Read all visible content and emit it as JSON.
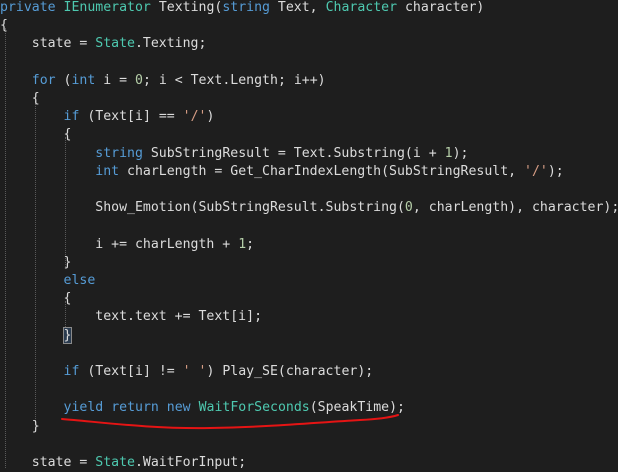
{
  "colors": {
    "background": "#1e1e1e",
    "plain": "#dcdcdc",
    "keyword": "#569cd6",
    "type": "#4ec9b0",
    "string": "#d69d85",
    "number": "#b5cea8",
    "squiggle": "#e51414",
    "indent_guide": "#5a5a5a"
  },
  "code_lines": [
    {
      "tokens": [
        {
          "t": "private",
          "c": "keyword"
        },
        {
          "t": " "
        },
        {
          "t": "IEnumerator",
          "c": "type"
        },
        {
          "t": " Texting("
        },
        {
          "t": "string",
          "c": "keyword"
        },
        {
          "t": " Text, "
        },
        {
          "t": "Character",
          "c": "type"
        },
        {
          "t": " character)"
        }
      ]
    },
    {
      "tokens": [
        {
          "t": "{"
        }
      ]
    },
    {
      "tokens": [
        {
          "t": "    state = "
        },
        {
          "t": "State",
          "c": "type"
        },
        {
          "t": ".Texting;"
        }
      ]
    },
    {
      "tokens": []
    },
    {
      "tokens": [
        {
          "t": "    "
        },
        {
          "t": "for",
          "c": "keyword"
        },
        {
          "t": " ("
        },
        {
          "t": "int",
          "c": "keyword"
        },
        {
          "t": " i = "
        },
        {
          "t": "0",
          "c": "number"
        },
        {
          "t": "; i < Text.Length; i++)"
        }
      ]
    },
    {
      "tokens": [
        {
          "t": "    {"
        }
      ]
    },
    {
      "tokens": [
        {
          "t": "        "
        },
        {
          "t": "if",
          "c": "keyword"
        },
        {
          "t": " (Text[i] == "
        },
        {
          "t": "'/'",
          "c": "string"
        },
        {
          "t": ")"
        }
      ]
    },
    {
      "tokens": [
        {
          "t": "        {"
        }
      ]
    },
    {
      "tokens": [
        {
          "t": "            "
        },
        {
          "t": "string",
          "c": "keyword"
        },
        {
          "t": " SubStringResult = Text.Substring(i + "
        },
        {
          "t": "1",
          "c": "number"
        },
        {
          "t": ");"
        }
      ]
    },
    {
      "tokens": [
        {
          "t": "            "
        },
        {
          "t": "int",
          "c": "keyword"
        },
        {
          "t": " charLength = Get_CharIndexLength(SubStringResult, "
        },
        {
          "t": "'/'",
          "c": "string"
        },
        {
          "t": ");"
        }
      ]
    },
    {
      "tokens": []
    },
    {
      "tokens": [
        {
          "t": "            Show_Emotion(SubStringResult.Substring("
        },
        {
          "t": "0",
          "c": "number"
        },
        {
          "t": ", charLength), character);"
        }
      ]
    },
    {
      "tokens": []
    },
    {
      "tokens": [
        {
          "t": "            i += charLength + "
        },
        {
          "t": "1",
          "c": "number"
        },
        {
          "t": ";"
        }
      ]
    },
    {
      "tokens": [
        {
          "t": "        }"
        }
      ]
    },
    {
      "tokens": [
        {
          "t": "        "
        },
        {
          "t": "else",
          "c": "keyword"
        }
      ]
    },
    {
      "tokens": [
        {
          "t": "        {"
        }
      ]
    },
    {
      "tokens": [
        {
          "t": "            text.text += Text[i];"
        }
      ]
    },
    {
      "tokens": [
        {
          "t": "        "
        },
        {
          "t": "}",
          "hl": true
        }
      ]
    },
    {
      "tokens": []
    },
    {
      "tokens": [
        {
          "t": "        "
        },
        {
          "t": "if",
          "c": "keyword"
        },
        {
          "t": " (Text[i] != "
        },
        {
          "t": "' '",
          "c": "string"
        },
        {
          "t": ") Play_SE(character);"
        }
      ]
    },
    {
      "tokens": []
    },
    {
      "tokens": [
        {
          "t": "        "
        },
        {
          "t": "yield",
          "c": "keyword"
        },
        {
          "t": " "
        },
        {
          "t": "return",
          "c": "keyword"
        },
        {
          "t": " "
        },
        {
          "t": "new",
          "c": "keyword"
        },
        {
          "t": " "
        },
        {
          "t": "WaitForSeconds",
          "c": "type"
        },
        {
          "t": "(SpeakTime);"
        }
      ]
    },
    {
      "tokens": [
        {
          "t": "    }"
        }
      ]
    },
    {
      "tokens": []
    },
    {
      "tokens": [
        {
          "t": "    state = "
        },
        {
          "t": "State",
          "c": "type"
        },
        {
          "t": ".WaitForInput;"
        }
      ]
    }
  ]
}
